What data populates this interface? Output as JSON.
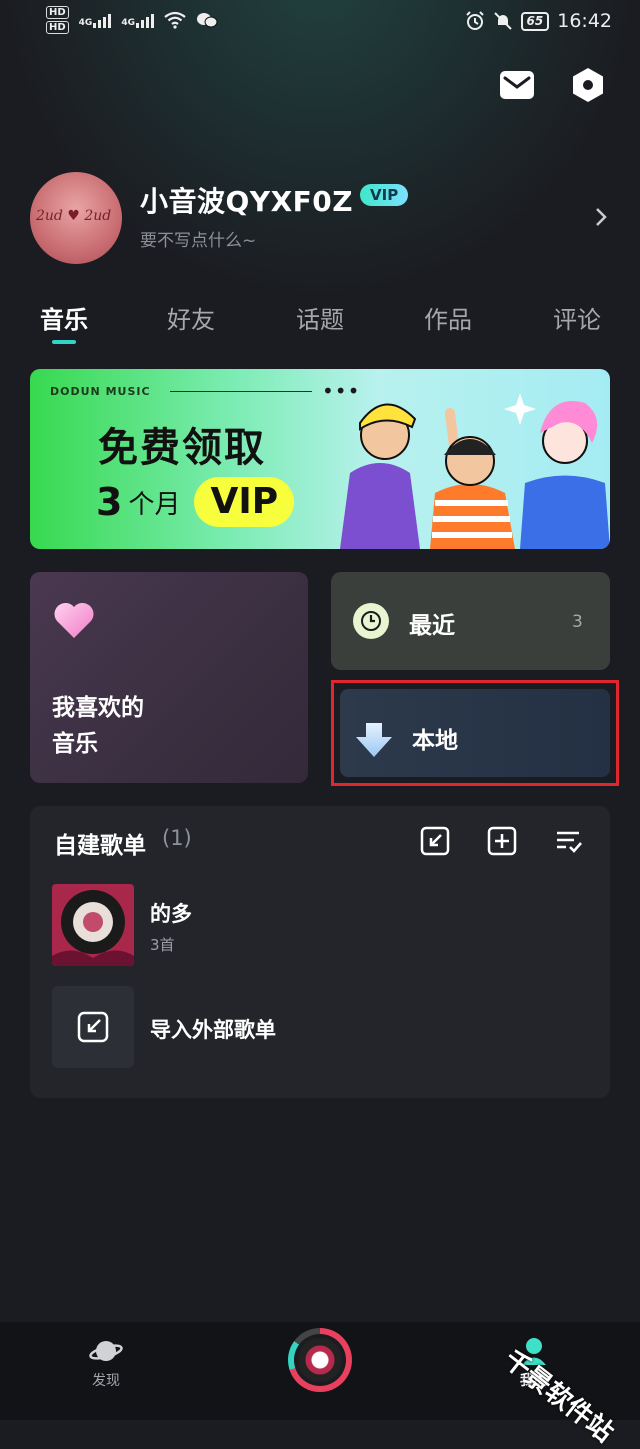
{
  "status_bar": {
    "sim1": "HD",
    "sim2": "HD",
    "net1": "4G",
    "net2": "4G",
    "battery": "65",
    "time": "16:42"
  },
  "header": {
    "mail_icon": "mail-icon",
    "settings_icon": "hexagon-settings-icon"
  },
  "profile": {
    "username": "小音波QYXF0Z",
    "vip_badge": "VIP",
    "bio": "要不写点什么~"
  },
  "tabs": [
    {
      "label": "音乐",
      "active": true
    },
    {
      "label": "好友",
      "active": false
    },
    {
      "label": "话题",
      "active": false
    },
    {
      "label": "作品",
      "active": false
    },
    {
      "label": "评论",
      "active": false
    }
  ],
  "banner": {
    "brand": "DODUN MUSIC",
    "title": "免费领取",
    "num": "3",
    "unit": "个月",
    "vip": "VIP"
  },
  "cards": {
    "like_line1": "我喜欢的",
    "like_line2": "音乐",
    "recent_label": "最近",
    "recent_count": "3",
    "local_label": "本地"
  },
  "playlists": {
    "title": "自建歌单",
    "count": "(1)",
    "items": [
      {
        "name": "的多",
        "sub": "3首"
      }
    ],
    "import_label": "导入外部歌单"
  },
  "bottom_nav": {
    "discover": "发现",
    "mine": "我的"
  },
  "watermark": "千景软件站",
  "colors": {
    "accent": "#30d5c8",
    "highlight_border": "#e0262e",
    "background": "#1b1c21"
  }
}
